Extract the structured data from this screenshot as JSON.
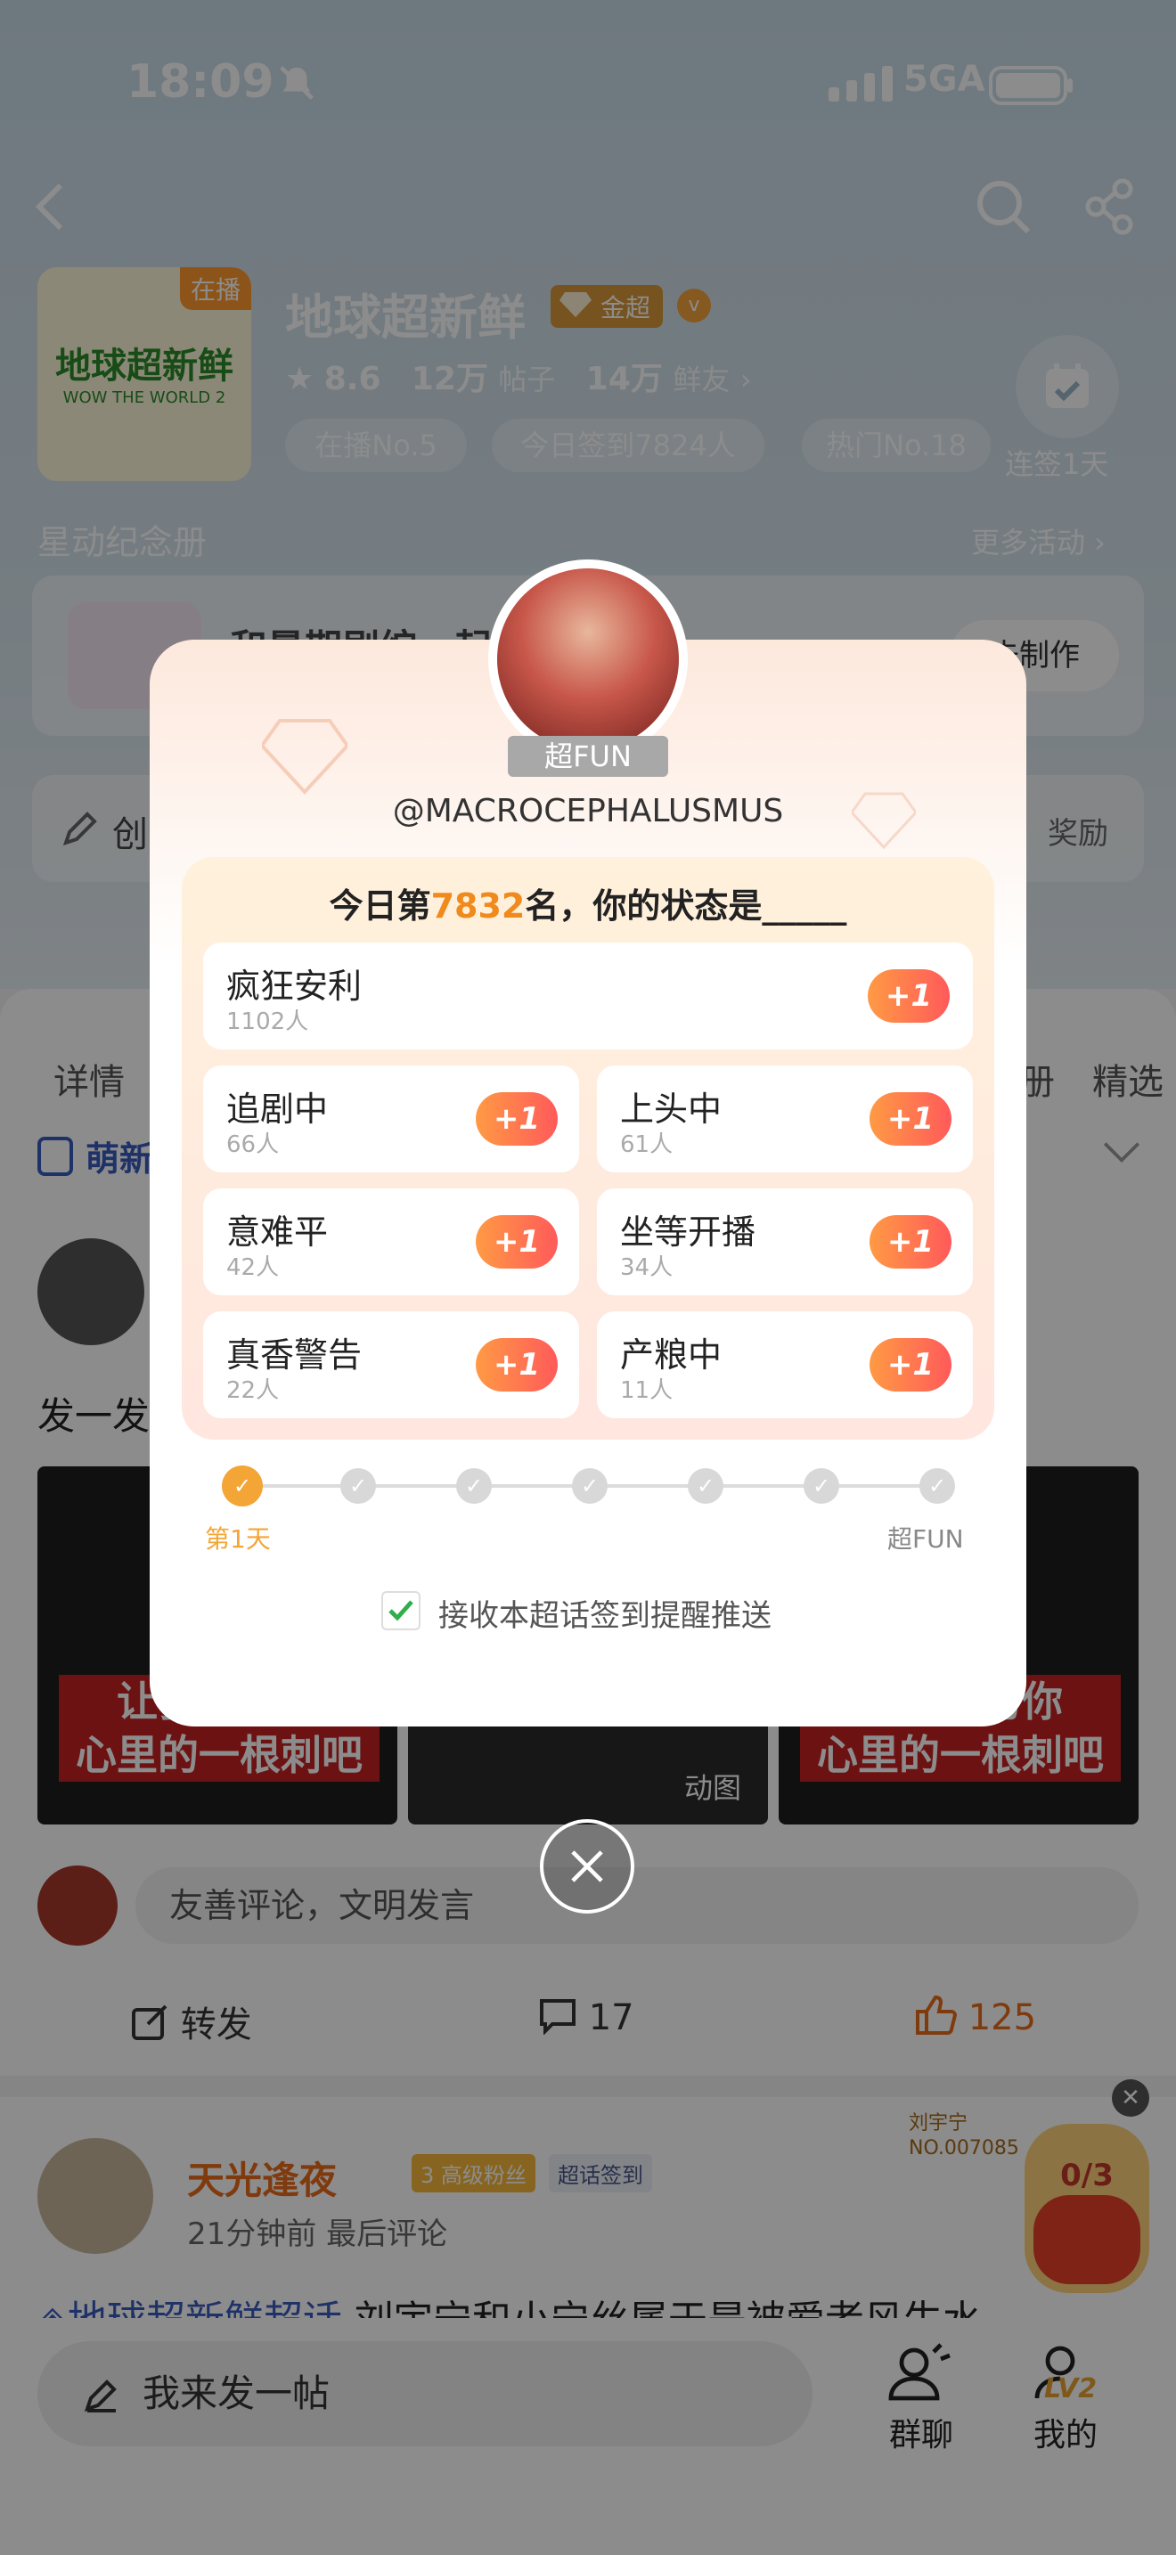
{
  "status": {
    "time": "18:09",
    "network": "5GA"
  },
  "header": {
    "live_tag": "在播",
    "logo_text": "地球超新鲜",
    "logo_sub": "WOW THE WORLD 2",
    "title": "地球超新鲜",
    "gold_badge": "金超",
    "rating": "8.6",
    "posts_count": "12万",
    "posts_unit": "帖子",
    "fans_count": "14万",
    "fans_unit": "鲜友",
    "chips": [
      "在播No.5",
      "今日签到7824人",
      "热门No.18"
    ],
    "sign_streak": "连签1天",
    "section_title": "星动纪念册",
    "more_activity": "更多活动 ›",
    "album_title": "和暑期剧综一起",
    "album_btn": "去制作",
    "create_left": "创",
    "create_right": "奖励"
  },
  "tabs": [
    "详情",
    "精选"
  ],
  "tab_mid": "册",
  "subrow_label": "萌新",
  "post1": {
    "text": "发一发",
    "img1_text": "让我成为你\n心里的一根刺吧",
    "img2_gif": "动图",
    "img3_text": "让我成为你\n心里的一根刺吧",
    "comment_placeholder": "友善评论，文明发言",
    "repost": "转发",
    "comments": "17",
    "likes": "125"
  },
  "post2": {
    "name": "天光逢夜",
    "badge_fans": "高级粉丝",
    "badge_fans_level": "3",
    "badge_sign": "超话签到",
    "time": "21分钟前 最后评论",
    "tag": "地球超新鲜超话",
    "text": " 刘宇宁和小宁丝属于是被爱者风生水"
  },
  "floating": {
    "counter": "0/3",
    "card_name": "刘宇宁",
    "card_no": "NO.007085"
  },
  "bottom": {
    "post_btn": "我来发一帖",
    "nav_group": "群聊",
    "nav_mine": "我的",
    "level": "LV2"
  },
  "modal": {
    "avatar_badge": "超FUN",
    "handle": "@MACROCEPHALUSMUS",
    "question_pre": "今日第",
    "question_rank": "7832",
    "question_post": "名，你的状态是_____",
    "plus_label": "+1",
    "options": [
      {
        "label": "疯狂安利",
        "count": "1102人"
      },
      {
        "label": "追剧中",
        "count": "66人"
      },
      {
        "label": "上头中",
        "count": "61人"
      },
      {
        "label": "意难平",
        "count": "42人"
      },
      {
        "label": "坐等开播",
        "count": "34人"
      },
      {
        "label": "真香警告",
        "count": "22人"
      },
      {
        "label": "产粮中",
        "count": "11人"
      }
    ],
    "steps_total": 7,
    "steps_done": 1,
    "step_first_label": "第1天",
    "step_last_label": "超FUN",
    "remind_label": "接收本超话签到提醒推送",
    "remind_checked": true
  },
  "colors": {
    "accent_orange": "#f3a536",
    "plus_gradient_start": "#ff9a44",
    "plus_gradient_end": "#ff5a5a",
    "link_blue": "#3a5bbd",
    "like_orange": "#e86a1a"
  }
}
